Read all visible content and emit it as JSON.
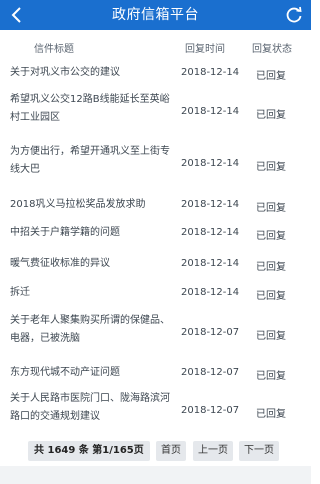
{
  "header": {
    "title": "政府信箱平台"
  },
  "columns": {
    "title": "信件标题",
    "time": "回复时间",
    "status": "回复状态"
  },
  "rows": [
    {
      "title": "关于对巩义市公交的建议",
      "date": "2018-12-14",
      "status": "已回复"
    },
    {
      "title": "希望巩义公交12路B线能延长至英峪村工业园区",
      "date": "2018-12-14",
      "status": "已回复"
    },
    {
      "title": "为方便出行，希望开通巩义至上街专线大巴",
      "date": "2018-12-14",
      "status": "已回复"
    },
    {
      "title": "2018巩义马拉松奖品发放求助",
      "date": "2018-12-14",
      "status": "已回复"
    },
    {
      "title": "中招关于户籍学籍的问题",
      "date": "2018-12-14",
      "status": "已回复"
    },
    {
      "title": "暖气费征收标准的异议",
      "date": "2018-12-14",
      "status": "已回复"
    },
    {
      "title": "拆迁",
      "date": "2018-12-14",
      "status": "已回复"
    },
    {
      "title": "关于老年人聚集购买所谓的保健品、电器，已被洗脑",
      "date": "2018-12-07",
      "status": "已回复"
    },
    {
      "title": "东方现代城不动产证问题",
      "date": "2018-12-07",
      "status": "已回复"
    },
    {
      "title": "关于人民路市医院门口、陇海路滨河路口的交通规划建议",
      "date": "2018-12-07",
      "status": "已回复"
    }
  ],
  "pager": {
    "info": "共 1649 条 第1/165页",
    "first": "首页",
    "prev": "上一页",
    "next": "下一页"
  },
  "colors": {
    "header_bg": "#1a6fcf",
    "text": "#3c4650",
    "pager_bg": "#e5e8ec"
  }
}
